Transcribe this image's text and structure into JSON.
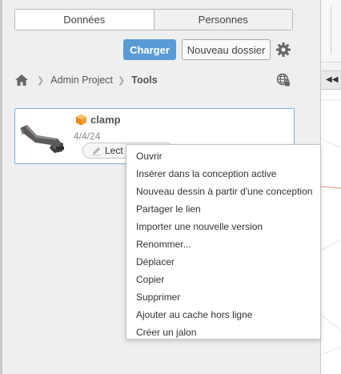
{
  "tabs": [
    {
      "label": "Données",
      "active": true
    },
    {
      "label": "Personnes",
      "active": false
    }
  ],
  "toolbar": {
    "upload_label": "Charger",
    "new_folder_label": "Nouveau dossier",
    "settings_icon": "gear-icon"
  },
  "breadcrumb": {
    "home_icon": "home-icon",
    "items": [
      "Admin Project",
      "Tools"
    ],
    "globe_icon": "globe-icon"
  },
  "file": {
    "name": "clamp",
    "date": "4/4/24",
    "status": "Lect",
    "icon": "design-cube-icon"
  },
  "context_menu": {
    "items": [
      "Ouvrir",
      "Insérer dans la conception active",
      "Nouveau dessin à partir d'une conception",
      "Partager le lien",
      "Importer une nouvelle version",
      "Renommer...",
      "Déplacer",
      "Copier",
      "Supprimer",
      "Ajouter au cache hors ligne",
      "Créer un jalon"
    ]
  },
  "colors": {
    "accent": "#5b9bd5",
    "selection_border": "#7aaede",
    "cube": "#f0a030"
  }
}
